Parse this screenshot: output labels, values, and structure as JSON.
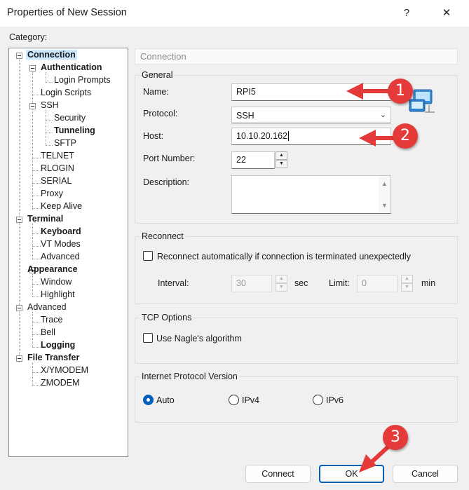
{
  "window": {
    "title": "Properties of New Session",
    "help_icon": "?",
    "close_icon": "✕"
  },
  "category_label": "Category:",
  "tree": {
    "connection": "Connection",
    "authentication": "Authentication",
    "login_prompts": "Login Prompts",
    "login_scripts": "Login Scripts",
    "ssh": "SSH",
    "security": "Security",
    "tunneling": "Tunneling",
    "sftp": "SFTP",
    "telnet": "TELNET",
    "rlogin": "RLOGIN",
    "serial": "SERIAL",
    "proxy": "Proxy",
    "keep_alive": "Keep Alive",
    "terminal": "Terminal",
    "keyboard": "Keyboard",
    "vt_modes": "VT Modes",
    "advanced_terminal": "Advanced",
    "appearance": "Appearance",
    "window": "Window",
    "highlight": "Highlight",
    "advanced": "Advanced",
    "trace": "Trace",
    "bell": "Bell",
    "logging": "Logging",
    "file_transfer": "File Transfer",
    "xymodem": "X/YMODEM",
    "zmodem": "ZMODEM"
  },
  "panel_header": "Connection",
  "general": {
    "legend": "General",
    "name_label": "Name:",
    "name_value": "RPI5",
    "protocol_label": "Protocol:",
    "protocol_value": "SSH",
    "host_label": "Host:",
    "host_value": "10.10.20.162",
    "port_label": "Port Number:",
    "port_value": "22",
    "description_label": "Description:"
  },
  "reconnect": {
    "legend": "Reconnect",
    "checkbox_label": "Reconnect automatically if connection is terminated unexpectedly",
    "interval_label": "Interval:",
    "interval_value": "30",
    "interval_unit": "sec",
    "limit_label": "Limit:",
    "limit_value": "0",
    "limit_unit": "min"
  },
  "tcp": {
    "legend": "TCP Options",
    "nagle_label": "Use Nagle's algorithm"
  },
  "ip_version": {
    "legend": "Internet Protocol Version",
    "auto": "Auto",
    "ipv4": "IPv4",
    "ipv6": "IPv6",
    "selected": "Auto"
  },
  "buttons": {
    "connect": "Connect",
    "ok": "OK",
    "cancel": "Cancel"
  },
  "callouts": [
    "1",
    "2",
    "3"
  ],
  "colors": {
    "callout_red": "#e53a3a",
    "accent_blue": "#005fb8",
    "selection": "#cce8ff"
  },
  "icons": {
    "session": "computer-network-icon"
  }
}
